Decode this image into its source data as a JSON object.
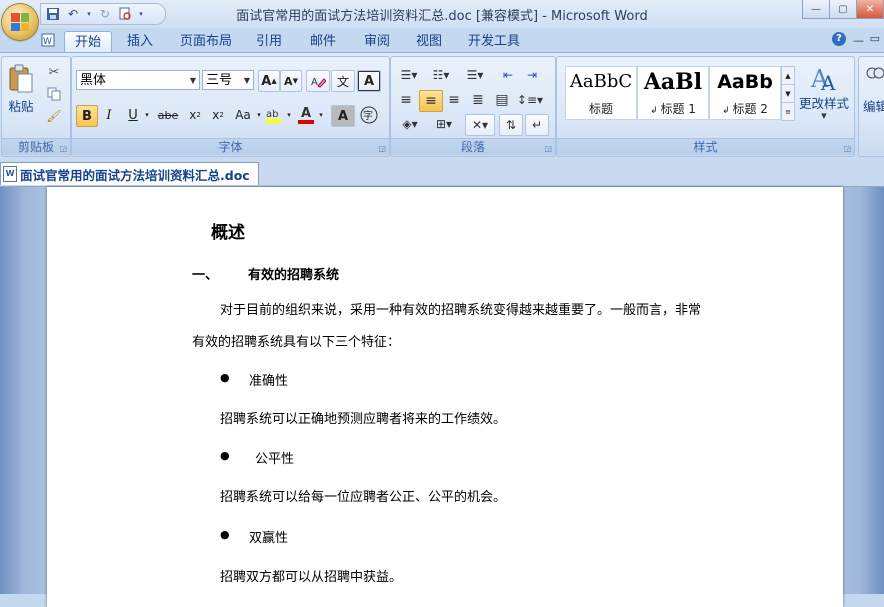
{
  "window": {
    "title": "面试官常用的面试方法培训资料汇总.doc [兼容模式] - Microsoft Word"
  },
  "ribbon_tabs": [
    "开始",
    "插入",
    "页面布局",
    "引用",
    "邮件",
    "审阅",
    "视图",
    "开发工具"
  ],
  "groups": {
    "clipboard": {
      "label": "剪贴板",
      "paste": "粘贴"
    },
    "font": {
      "label": "字体",
      "font_name": "黑体",
      "font_size": "三号"
    },
    "paragraph": {
      "label": "段落"
    },
    "styles": {
      "label": "样式",
      "items": [
        {
          "sample": "AaBbC",
          "name": "标题"
        },
        {
          "sample": "AaBl",
          "name": "标题 1"
        },
        {
          "sample": "AaBb",
          "name": "标题 2"
        }
      ],
      "change_styles": "更改样式"
    },
    "editing": {
      "label": "编辑"
    }
  },
  "document_tab": "面试官常用的面试方法培训资料汇总.doc",
  "document": {
    "heading": "概述",
    "section_number": "一、",
    "section_title": "有效的招聘系统",
    "intro_line1": "对于目前的组织来说，采用一种有效的招聘系统变得越来越重要了。一般而言，非常",
    "intro_line2": "有效的招聘系统具有以下三个特征：",
    "bullets": [
      {
        "title": "准确性",
        "desc": "招聘系统可以正确地预测应聘者将来的工作绩效。"
      },
      {
        "title": "公平性",
        "desc": "招聘系统可以给每一位应聘者公正、公平的机会。"
      },
      {
        "title": "双赢性",
        "desc": "招聘双方都可以从招聘中获益。"
      }
    ],
    "bullet_char": "●"
  }
}
